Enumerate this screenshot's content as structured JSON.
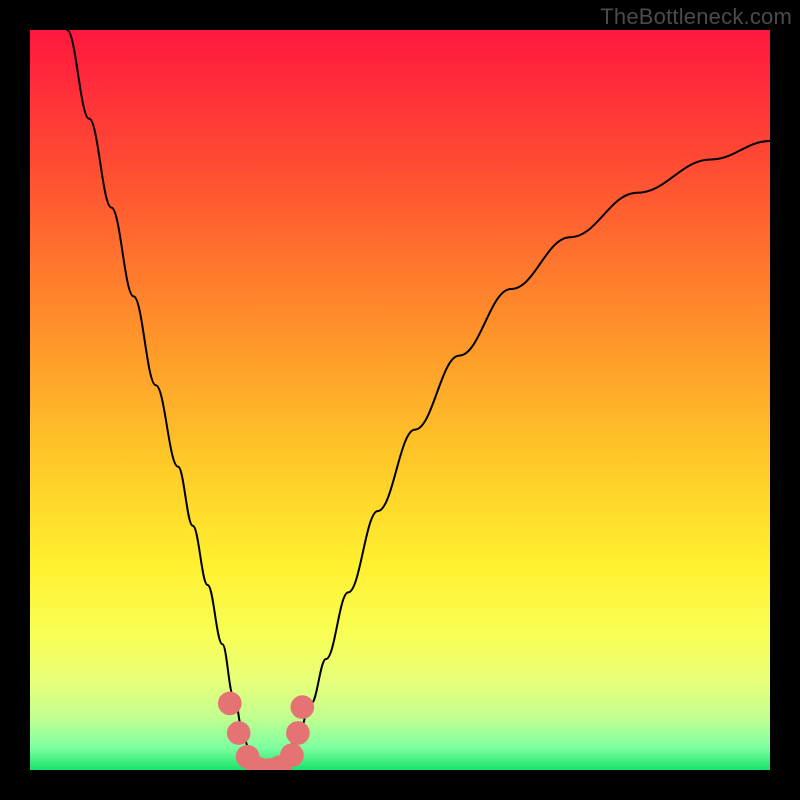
{
  "watermark": "TheBottleneck.com",
  "chart_data": {
    "type": "line",
    "title": "",
    "xlabel": "",
    "ylabel": "",
    "xlim": [
      0,
      100
    ],
    "ylim": [
      0,
      100
    ],
    "grid": false,
    "legend": false,
    "background_gradient": {
      "stops": [
        {
          "offset": 0.0,
          "color": "#ff173f"
        },
        {
          "offset": 0.18,
          "color": "#ff4b33"
        },
        {
          "offset": 0.38,
          "color": "#ff8a2b"
        },
        {
          "offset": 0.58,
          "color": "#ffc828"
        },
        {
          "offset": 0.72,
          "color": "#fff02f"
        },
        {
          "offset": 0.82,
          "color": "#f8ff56"
        },
        {
          "offset": 0.88,
          "color": "#e8ff7a"
        },
        {
          "offset": 0.93,
          "color": "#c0ff90"
        },
        {
          "offset": 0.97,
          "color": "#7dffa0"
        },
        {
          "offset": 1.0,
          "color": "#19e36a"
        }
      ]
    },
    "series": [
      {
        "name": "bottleneck-curve",
        "stroke": "#000000",
        "stroke_width": 2,
        "x": [
          5,
          8,
          11,
          14,
          17,
          20,
          22,
          24,
          26,
          27.5,
          29,
          30,
          31,
          32,
          33,
          34,
          36,
          38,
          40,
          43,
          47,
          52,
          58,
          65,
          73,
          82,
          92,
          100
        ],
        "y": [
          100,
          88,
          76,
          64,
          52,
          41,
          33,
          25,
          17,
          10,
          4,
          1,
          0,
          0,
          0.5,
          1.5,
          4,
          9,
          15,
          24,
          35,
          46,
          56,
          65,
          72,
          78,
          82.5,
          85
        ]
      }
    ],
    "markers": [
      {
        "name": "marker-left-top",
        "x": 27.0,
        "y": 9.0,
        "r": 1.6,
        "color": "#e57373"
      },
      {
        "name": "marker-left-mid",
        "x": 28.2,
        "y": 5.0,
        "r": 1.6,
        "color": "#e57373"
      },
      {
        "name": "marker-left-low",
        "x": 29.4,
        "y": 1.8,
        "r": 1.6,
        "color": "#e57373"
      },
      {
        "name": "marker-bottom-a",
        "x": 30.8,
        "y": 0.2,
        "r": 1.6,
        "color": "#e57373"
      },
      {
        "name": "marker-bottom-b",
        "x": 32.4,
        "y": 0.0,
        "r": 1.6,
        "color": "#e57373"
      },
      {
        "name": "marker-bottom-c",
        "x": 33.8,
        "y": 0.4,
        "r": 1.6,
        "color": "#e57373"
      },
      {
        "name": "marker-right-low",
        "x": 35.4,
        "y": 2.0,
        "r": 1.6,
        "color": "#e57373"
      },
      {
        "name": "marker-right-mid",
        "x": 36.2,
        "y": 5.0,
        "r": 1.6,
        "color": "#e57373"
      },
      {
        "name": "marker-right-top",
        "x": 36.8,
        "y": 8.5,
        "r": 1.6,
        "color": "#e57373"
      }
    ]
  }
}
